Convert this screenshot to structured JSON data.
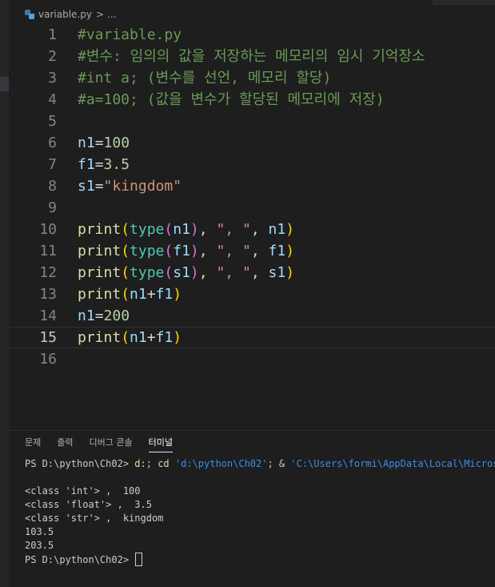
{
  "breadcrumb": {
    "file": "variable.py",
    "separator": ">",
    "more": "..."
  },
  "editor": {
    "current_line": 15,
    "lines": [
      {
        "n": "1",
        "tokens": [
          {
            "t": "#variable.py",
            "c": "cmt"
          }
        ]
      },
      {
        "n": "2",
        "tokens": [
          {
            "t": "#변수: 임의의 값을 저장하는 메모리의 임시 기억장소",
            "c": "cmt"
          }
        ]
      },
      {
        "n": "3",
        "tokens": [
          {
            "t": "#int a; (변수를 선언, 메모리 할당)",
            "c": "cmt"
          }
        ]
      },
      {
        "n": "4",
        "tokens": [
          {
            "t": "#a=100; (값을 변수가 할당된 메모리에 저장)",
            "c": "cmt"
          }
        ]
      },
      {
        "n": "5",
        "tokens": []
      },
      {
        "n": "6",
        "tokens": [
          {
            "t": "n1",
            "c": "var"
          },
          {
            "t": "=",
            "c": "op"
          },
          {
            "t": "100",
            "c": "num"
          }
        ]
      },
      {
        "n": "7",
        "tokens": [
          {
            "t": "f1",
            "c": "var"
          },
          {
            "t": "=",
            "c": "op"
          },
          {
            "t": "3.5",
            "c": "num"
          }
        ]
      },
      {
        "n": "8",
        "tokens": [
          {
            "t": "s1",
            "c": "var"
          },
          {
            "t": "=",
            "c": "op"
          },
          {
            "t": "\"kingdom\"",
            "c": "str"
          }
        ]
      },
      {
        "n": "9",
        "tokens": []
      },
      {
        "n": "10",
        "tokens": [
          {
            "t": "print",
            "c": "fn"
          },
          {
            "t": "(",
            "c": "p1"
          },
          {
            "t": "type",
            "c": "cls"
          },
          {
            "t": "(",
            "c": "p2"
          },
          {
            "t": "n1",
            "c": "var"
          },
          {
            "t": ")",
            "c": "p2"
          },
          {
            "t": ", ",
            "c": "op"
          },
          {
            "t": "\", \"",
            "c": "str"
          },
          {
            "t": ", ",
            "c": "op"
          },
          {
            "t": "n1",
            "c": "var"
          },
          {
            "t": ")",
            "c": "p1"
          }
        ]
      },
      {
        "n": "11",
        "tokens": [
          {
            "t": "print",
            "c": "fn"
          },
          {
            "t": "(",
            "c": "p1"
          },
          {
            "t": "type",
            "c": "cls"
          },
          {
            "t": "(",
            "c": "p2"
          },
          {
            "t": "f1",
            "c": "var"
          },
          {
            "t": ")",
            "c": "p2"
          },
          {
            "t": ", ",
            "c": "op"
          },
          {
            "t": "\", \"",
            "c": "str"
          },
          {
            "t": ", ",
            "c": "op"
          },
          {
            "t": "f1",
            "c": "var"
          },
          {
            "t": ")",
            "c": "p1"
          }
        ]
      },
      {
        "n": "12",
        "tokens": [
          {
            "t": "print",
            "c": "fn"
          },
          {
            "t": "(",
            "c": "p1"
          },
          {
            "t": "type",
            "c": "cls"
          },
          {
            "t": "(",
            "c": "p2"
          },
          {
            "t": "s1",
            "c": "var"
          },
          {
            "t": ")",
            "c": "p2"
          },
          {
            "t": ", ",
            "c": "op"
          },
          {
            "t": "\", \"",
            "c": "str"
          },
          {
            "t": ", ",
            "c": "op"
          },
          {
            "t": "s1",
            "c": "var"
          },
          {
            "t": ")",
            "c": "p1"
          }
        ]
      },
      {
        "n": "13",
        "tokens": [
          {
            "t": "print",
            "c": "fn"
          },
          {
            "t": "(",
            "c": "p1"
          },
          {
            "t": "n1",
            "c": "var"
          },
          {
            "t": "+",
            "c": "op"
          },
          {
            "t": "f1",
            "c": "var"
          },
          {
            "t": ")",
            "c": "p1"
          }
        ]
      },
      {
        "n": "14",
        "tokens": [
          {
            "t": "n1",
            "c": "var"
          },
          {
            "t": "=",
            "c": "op"
          },
          {
            "t": "200",
            "c": "num"
          }
        ]
      },
      {
        "n": "15",
        "tokens": [
          {
            "t": "print",
            "c": "fn"
          },
          {
            "t": "(",
            "c": "p1"
          },
          {
            "t": "n1",
            "c": "var"
          },
          {
            "t": "+",
            "c": "op"
          },
          {
            "t": "f1",
            "c": "var"
          },
          {
            "t": ")",
            "c": "p1"
          }
        ]
      },
      {
        "n": "16",
        "tokens": []
      }
    ]
  },
  "panel": {
    "tabs": [
      {
        "label": "문제",
        "active": false
      },
      {
        "label": "출력",
        "active": false
      },
      {
        "label": "디버그 콘솔",
        "active": false
      },
      {
        "label": "터미널",
        "active": true
      }
    ],
    "terminal": {
      "command_line": {
        "prompt": "PS D:\\python\\Ch02> ",
        "cmd": "d:",
        "rest1": "; ",
        "cd": "cd",
        "space": " ",
        "path1": "'d:\\python\\Ch02'",
        "rest2": "; & ",
        "path2": "'C:\\Users\\formi\\AppData\\Local\\Microso"
      },
      "output": [
        "<class 'int'> ,  100",
        "<class 'float'> ,  3.5",
        "<class 'str'> ,  kingdom",
        "103.5",
        "203.5"
      ],
      "final_prompt": "PS D:\\python\\Ch02> "
    }
  }
}
